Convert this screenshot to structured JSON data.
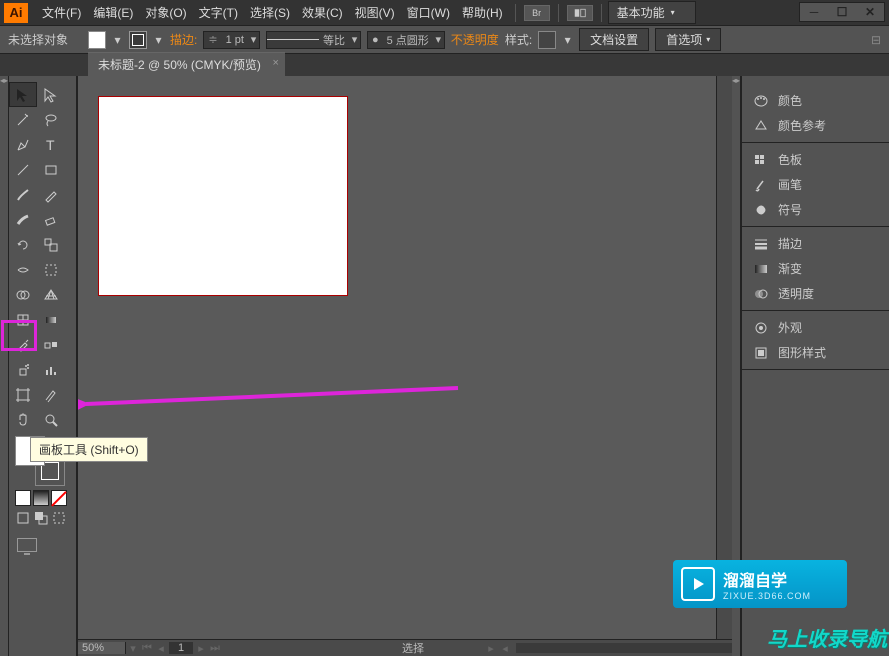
{
  "app": {
    "logo": "Ai"
  },
  "menu": [
    "文件(F)",
    "编辑(E)",
    "对象(O)",
    "文字(T)",
    "选择(S)",
    "效果(C)",
    "视图(V)",
    "窗口(W)",
    "帮助(H)"
  ],
  "workspace": "基本功能",
  "control": {
    "no_selection": "未选择对象",
    "stroke_label": "描边",
    "stroke_value": "1 pt",
    "uniform": "等比",
    "brush": "5 点圆形",
    "opacity": "不透明度",
    "style": "样式",
    "doc_setup": "文档设置",
    "prefs": "首选项"
  },
  "document": {
    "tab": "未标题-2 @ 50% (CMYK/预览)",
    "zoom": "50%",
    "page": "1",
    "status": "选择"
  },
  "tooltip": "画板工具 (Shift+O)",
  "panels": {
    "color": "颜色",
    "color_guide": "颜色参考",
    "swatches": "色板",
    "brushes": "画笔",
    "symbols": "符号",
    "stroke": "描边",
    "gradient": "渐变",
    "transparency": "透明度",
    "appearance": "外观",
    "graphic_styles": "图形样式"
  },
  "watermark": {
    "brand": "溜溜自学",
    "brand_sub": "ZIXUE.3D66.COM",
    "badge2": "马上收录导航"
  }
}
